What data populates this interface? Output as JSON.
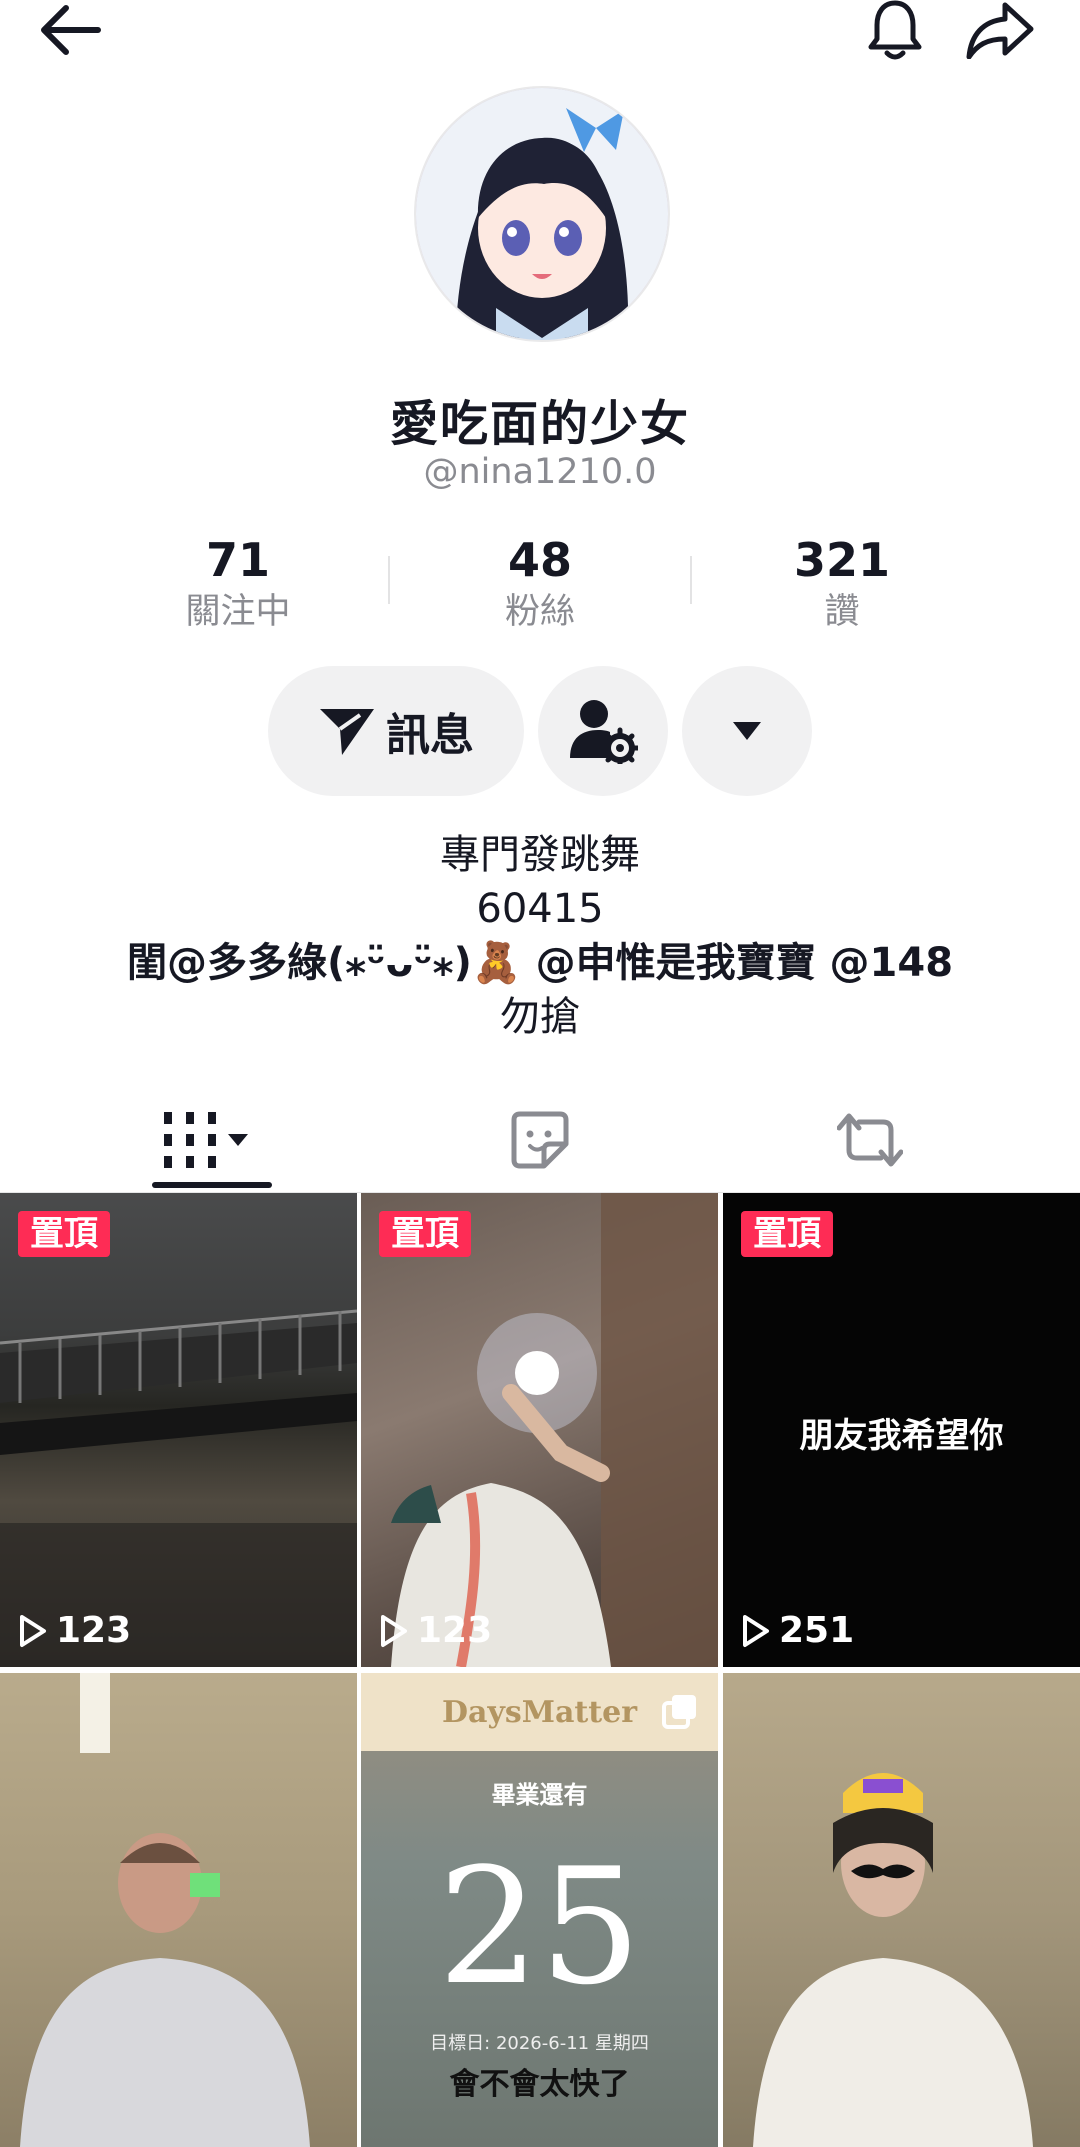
{
  "header": {
    "back_icon": "arrow-left-icon",
    "notification_icon": "bell-icon",
    "share_icon": "share-arrow-icon"
  },
  "profile": {
    "display_name": "愛吃面的少女",
    "handle": "@nina1210.0",
    "stats": [
      {
        "value": "71",
        "label": "關注中"
      },
      {
        "value": "48",
        "label": "粉絲"
      },
      {
        "value": "321",
        "label": "讚"
      }
    ],
    "message_button": "訊息",
    "bio_lines": [
      "專門發跳舞",
      "60415",
      "閨@多多綠(⁎ᵕ̈ᴗᵕ̈⁎)🧸 @申惟是我寶寶 @148",
      "勿搶"
    ]
  },
  "tabs": [
    "videos-grid-icon",
    "liked-sticker-icon",
    "repost-icon"
  ],
  "videos": [
    {
      "pinned_label": "置頂",
      "views": "123",
      "overlay_text": ""
    },
    {
      "pinned_label": "置頂",
      "views": "123",
      "overlay_text": ""
    },
    {
      "pinned_label": "置頂",
      "views": "251",
      "overlay_text": "朋友我希望你"
    },
    {
      "pinned_label": "",
      "views": "",
      "overlay_text": ""
    },
    {
      "pinned_label": "",
      "views": "",
      "overlay_text": "",
      "app_name": "DaysMatter",
      "subtitle": "畢業還有",
      "count": "25",
      "date_text": "目標日: 2026-6-11 星期四",
      "bottom_text": "會不會太快了"
    },
    {
      "pinned_label": "",
      "views": "",
      "overlay_text": ""
    }
  ],
  "colors": {
    "accent": "#fe2c55",
    "text": "#161823",
    "muted": "#8a8b91",
    "button_bg": "#f1f1f2"
  }
}
